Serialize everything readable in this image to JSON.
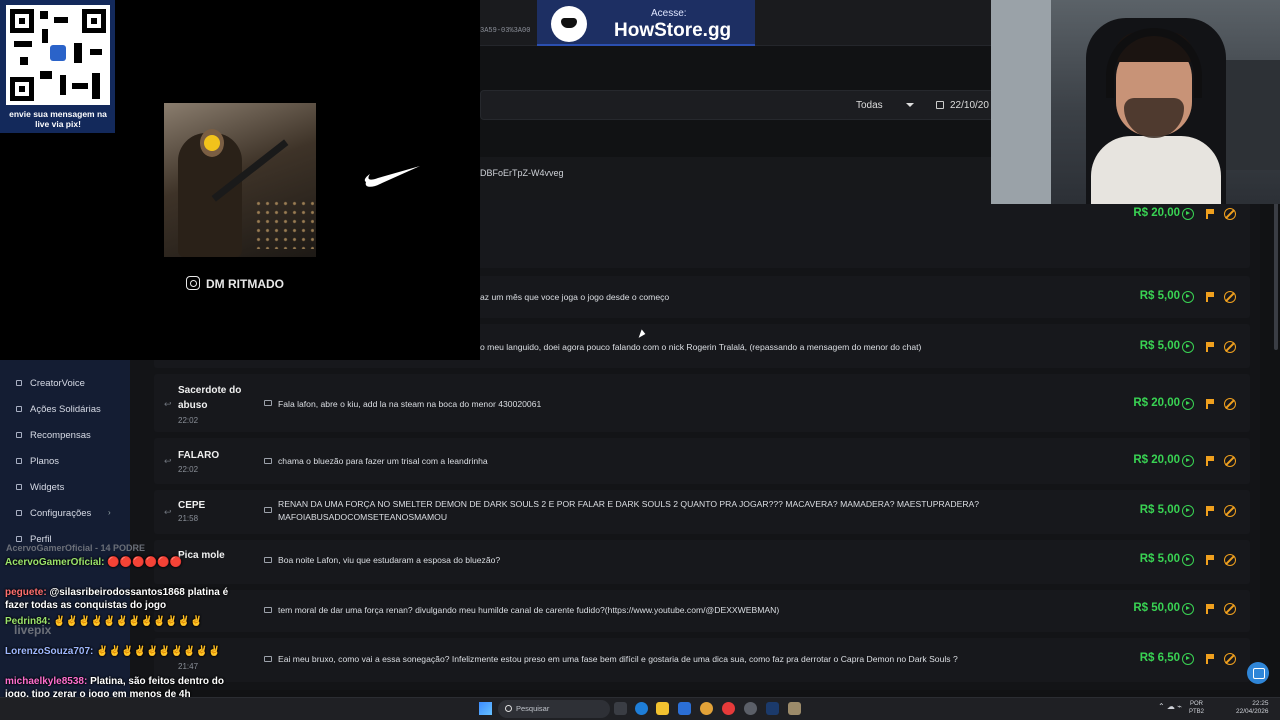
{
  "top_banner": {
    "access_label": "Acesse:",
    "store_name": "HowStore.gg"
  },
  "url_fragment": "3A59-03%3A00",
  "filters": {
    "type_select": "Todas",
    "date": "22/10/20"
  },
  "header_row_text": "DBFoErTpZ-W4vveg",
  "qr_caption": "envie sua mensagem na live via pix!",
  "promo": {
    "instagram_handle": "DM RITMADO"
  },
  "sidebar": {
    "items": [
      {
        "label": "CreatorVoice"
      },
      {
        "label": "Ações Solidárias"
      },
      {
        "label": "Recompensas"
      },
      {
        "label": "Planos"
      },
      {
        "label": "Widgets"
      },
      {
        "label": "Configurações",
        "chevron": "›"
      },
      {
        "label": "Perfil"
      }
    ]
  },
  "donations": [
    {
      "name": "",
      "time": "",
      "message": "",
      "amount": "R$ 20,00"
    },
    {
      "name": "",
      "time": "",
      "message": "az um mês que voce joga o jogo desde o começo",
      "amount": "R$ 5,00"
    },
    {
      "name": "",
      "time": "",
      "message": "o meu languido, doei agora pouco falando com o nick Rogerin Tralalá, (repassando a mensagem do menor do chat)",
      "amount": "R$ 5,00"
    },
    {
      "name": "Sacerdote do abuso",
      "time": "22:02",
      "message": "Fala lafon, abre o kiu, add la na steam na boca do menor 430020061",
      "amount": "R$ 20,00"
    },
    {
      "name": "FALARO",
      "time": "22:02",
      "message": "chama o bluezão para fazer um trisal com a leandrinha",
      "amount": "R$ 20,00"
    },
    {
      "name": "CEPE",
      "time": "21:58",
      "message": "RENAN DA UMA FORÇA NO SMELTER DEMON DE DARK SOULS 2 E POR FALAR E DARK SOULS 2 QUANTO PRA JOGAR??? MACAVERA? MAMADERA? MAESTUPRADERA? MAFOIABUSADOCOMSETEANOSMAMOU",
      "amount": "R$ 5,00"
    },
    {
      "name": "Pica mole",
      "time": "",
      "message": "Boa noite Lafon, viu que estudaram a esposa do bluezão?",
      "amount": "R$ 5,00"
    },
    {
      "name": "",
      "time": "",
      "message": "tem moral de dar uma força renan? divulgando meu humilde canal de carente fudido?(https://www.youtube.com/@DEXXWEBMAN)",
      "amount": "R$ 50,00"
    },
    {
      "name": "",
      "time": "21:47",
      "message": "Eai meu bruxo, como vai a essa sonegação? Infelizmente estou preso em uma fase bem difícil e gostaria de uma dica sua, como faz pra derrotar o Capra Demon no Dark Souls ?",
      "amount": "R$ 6,50"
    }
  ],
  "chat": [
    {
      "user": "AcervoGamerOficial:",
      "text": "🔴🔴🔴🔴🔴🔴"
    },
    {
      "user": "peguete:",
      "text": "@silasribeirodossantos1868 platina é fazer todas as conquistas do jogo"
    },
    {
      "user": "Pedrin84:",
      "text": "✌✌✌✌✌✌✌✌✌✌✌✌"
    },
    {
      "user": "LorenzoSouza707:",
      "text": "✌✌✌✌✌✌✌✌✌✌"
    },
    {
      "user": "michaelkyle8538:",
      "text": "Platina, são feitos dentro do jogo, tipo zerar o jogo em menos de 4h"
    }
  ],
  "chat_ghost": {
    "line1": "AcervoGamerOficial - 14 PODRE",
    "line2": "livepix"
  },
  "taskbar": {
    "search_placeholder": "Pesquisar",
    "lang_top": "POR",
    "lang_bottom": "PTB2",
    "time": "22:25",
    "date": "22/04/2026"
  },
  "colors": {
    "amount_green": "#39d353",
    "action_orange": "#f0a01e",
    "sidebar_bg": "#141d33"
  }
}
